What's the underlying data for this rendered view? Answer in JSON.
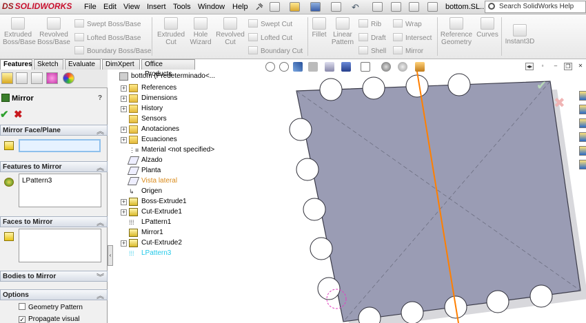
{
  "menubar": {
    "logo_prefix": "DS",
    "logo": "SOLIDWORKS",
    "items": [
      "File",
      "Edit",
      "View",
      "Insert",
      "Tools",
      "Window",
      "Help"
    ],
    "doc_title": "bottom.SL...",
    "search_placeholder": "Search SolidWorks Help"
  },
  "commands": {
    "extruded_boss": "Extruded Boss/Base",
    "revolved_boss": "Revolved Boss/Base",
    "swept_boss": "Swept Boss/Base",
    "lofted_boss": "Lofted Boss/Base",
    "boundary_boss": "Boundary Boss/Base",
    "extruded_cut": "Extruded Cut",
    "hole_wizard": "Hole Wizard",
    "revolved_cut": "Revolved Cut",
    "swept_cut": "Swept Cut",
    "lofted_cut": "Lofted Cut",
    "boundary_cut": "Boundary Cut",
    "fillet": "Fillet",
    "linear_pattern": "Linear Pattern",
    "rib": "Rib",
    "draft": "Draft",
    "shell": "Shell",
    "wrap": "Wrap",
    "intersect": "Intersect",
    "mirror": "Mirror",
    "reference_geometry": "Reference Geometry",
    "curves": "Curves",
    "instant3d": "Instant3D"
  },
  "tabs": [
    "Features",
    "Sketch",
    "Evaluate",
    "DimXpert",
    "Office Products"
  ],
  "pm": {
    "title": "Mirror",
    "help": "?",
    "ok": "✔",
    "cancel": "✖",
    "mirror_face_plane": "Mirror Face/Plane",
    "features_to_mirror": "Features to Mirror",
    "features_item": "LPattern3",
    "faces_to_mirror": "Faces to Mirror",
    "bodies_to_mirror": "Bodies to Mirror",
    "options": "Options",
    "geometry_pattern": "Geometry Pattern",
    "propagate_visual": "Propagate visual",
    "chevron_up": "︽",
    "chevron_down": "︾"
  },
  "tree": {
    "root": "bottom  (Predeterminado<...",
    "items": [
      {
        "label": "References"
      },
      {
        "label": "Dimensions"
      },
      {
        "label": "History"
      },
      {
        "label": "Sensors"
      },
      {
        "label": "Anotaciones"
      },
      {
        "label": "Ecuaciones"
      },
      {
        "label": "Material <not specified>"
      },
      {
        "label": "Alzado"
      },
      {
        "label": "Planta"
      },
      {
        "label": "Vista lateral"
      },
      {
        "label": "Origen"
      },
      {
        "label": "Boss-Extrude1"
      },
      {
        "label": "Cut-Extrude1"
      },
      {
        "label": "LPattern1"
      },
      {
        "label": "Mirror1"
      },
      {
        "label": "Cut-Extrude2"
      },
      {
        "label": "LPattern3"
      }
    ],
    "highlight_orange": "#d98a1a",
    "highlight_cyan": "#20c8e8"
  },
  "viewport": {
    "part_color": "#9a9cb4",
    "plane_line_color": "#ff7f00",
    "ok_glyph": "✔",
    "cancel_glyph": "✖"
  }
}
